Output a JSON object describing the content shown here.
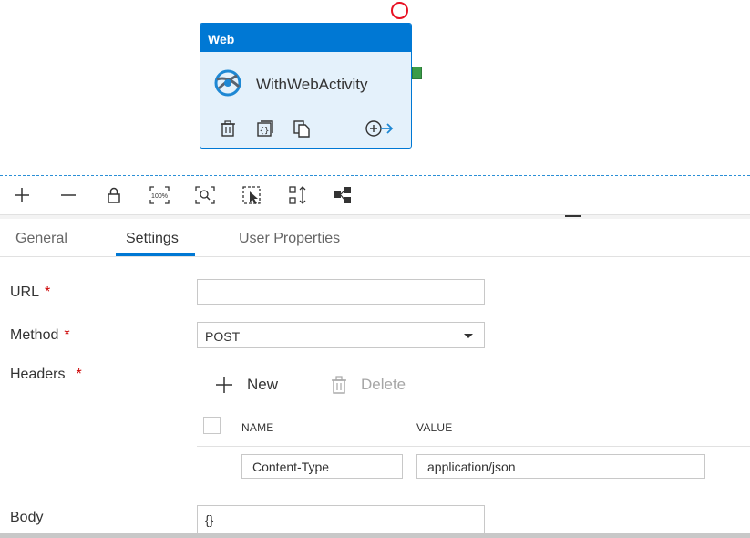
{
  "activity": {
    "type_label": "Web",
    "name": "WithWebActivity",
    "icons": [
      "web-activity-icon",
      "delete-icon",
      "code-icon",
      "copy-icon",
      "add-output-icon"
    ],
    "colors": {
      "header": "#0078d4",
      "body": "#e4f1fb",
      "error": "#e81123",
      "success": "#3a9c48"
    }
  },
  "toolbar": {
    "icons": [
      "plus-icon",
      "minus-icon",
      "lock-icon",
      "zoom-100-icon",
      "zoom-fit-icon",
      "select-icon",
      "auto-align-icon",
      "layout-icon"
    ],
    "zoom_100_label": "100%"
  },
  "tabs": [
    {
      "label": "General",
      "active": false
    },
    {
      "label": "Settings",
      "active": true
    },
    {
      "label": "User Properties",
      "active": false
    }
  ],
  "form": {
    "url": {
      "label": "URL",
      "required": "*",
      "value": ""
    },
    "method": {
      "label": "Method",
      "required": "*",
      "value": "POST"
    },
    "headers": {
      "label": "Headers",
      "required": "*",
      "new_label": "New",
      "delete_label": "Delete",
      "columns": [
        "NAME",
        "VALUE"
      ],
      "rows": [
        {
          "name": "Content-Type",
          "value": "application/json"
        }
      ]
    },
    "body": {
      "label": "Body",
      "value": "{}"
    }
  },
  "colors": {
    "accent": "#0078d4",
    "required": "#cc0000"
  }
}
